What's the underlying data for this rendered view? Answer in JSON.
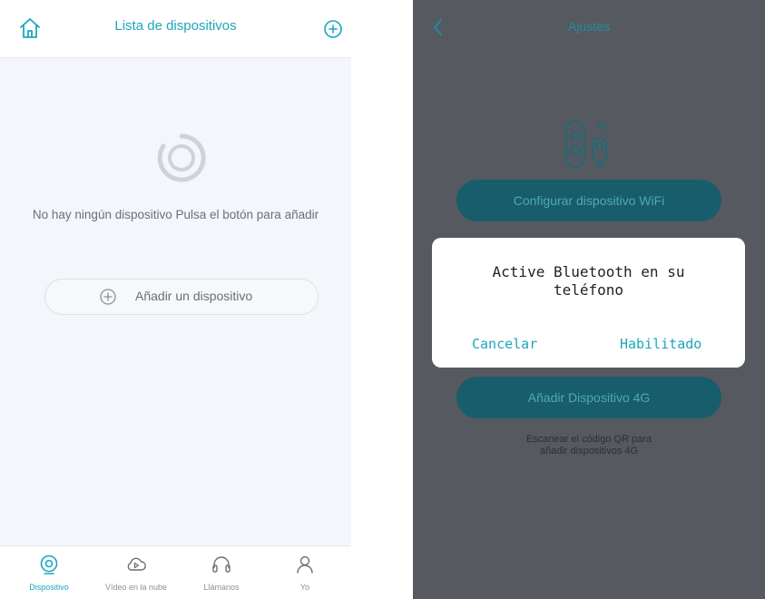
{
  "left_screen": {
    "header": {
      "title": "Lista de dispositivos",
      "left_icon": "home-icon",
      "right_icon": "add-circle-icon"
    },
    "empty_state": {
      "icon": "loading-ring-icon",
      "message": "No hay ningún dispositivo Pulsa el botón para añadir"
    },
    "add_device_button": {
      "icon": "plus-circle-icon",
      "label": "Añadir un dispositivo"
    },
    "bottom_nav": [
      {
        "label": "Dispositivo",
        "icon": "camera-icon",
        "active": true
      },
      {
        "label": "Vídeo en la nube",
        "icon": "cloud-play-icon",
        "active": false
      },
      {
        "label": "Llámanos",
        "icon": "headset-icon",
        "active": false
      },
      {
        "label": "Yo",
        "icon": "user-icon",
        "active": false
      }
    ]
  },
  "right_screen": {
    "header": {
      "title": "Ajustes",
      "back_icon": "chevron-left-icon"
    },
    "illustration_icon": "doorbell-camera-icon",
    "wifi_button_label": "Configurar dispositivo WiFi",
    "g4_button_label": "Añadir Dispositivo 4G",
    "qr_note": [
      "Escanear el código QR para",
      "añadir dispositivos 4G"
    ],
    "dialog": {
      "message_lines": [
        "Active Bluetooth en su",
        "teléfono"
      ],
      "cancel_label": "Cancelar",
      "confirm_label": "Habilitado"
    }
  },
  "colors": {
    "accent": "#1ba7bd",
    "overlay_background": "#565a60",
    "dimmed_button": "#185d6b"
  }
}
